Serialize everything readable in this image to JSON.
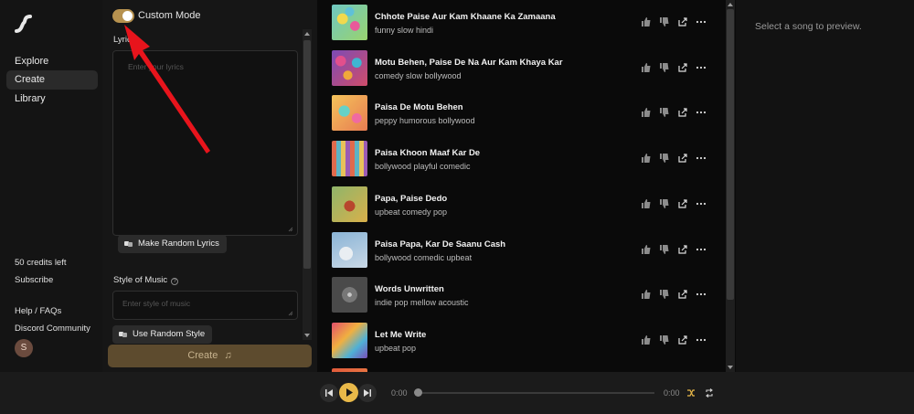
{
  "sidebar": {
    "nav": [
      {
        "label": "Explore"
      },
      {
        "label": "Create",
        "active": true
      },
      {
        "label": "Library"
      }
    ],
    "credits": "50 credits left",
    "subscribe": "Subscribe",
    "help": "Help / FAQs",
    "discord": "Discord Community",
    "avatar_initial": "S"
  },
  "create_panel": {
    "mode_label": "Custom Mode",
    "mode_on": true,
    "lyrics_label": "Lyrics",
    "lyrics_placeholder": "Enter your lyrics",
    "random_lyrics_label": "Make Random Lyrics",
    "style_label": "Style of Music",
    "style_placeholder": "Enter style of music",
    "random_style_label": "Use Random Style",
    "create_label": "Create"
  },
  "songs": [
    {
      "title": "Chhote Paise Aur Kam Khaane Ka Zamaana",
      "tags": "funny slow hindi"
    },
    {
      "title": "Motu Behen, Paise De Na Aur Kam Khaya Kar",
      "tags": "comedy slow bollywood"
    },
    {
      "title": "Paisa De Motu Behen",
      "tags": "peppy humorous bollywood"
    },
    {
      "title": "Paisa Khoon Maaf Kar De",
      "tags": "bollywood playful comedic"
    },
    {
      "title": "Papa, Paise Dedo",
      "tags": "upbeat comedy pop"
    },
    {
      "title": "Paisa Papa, Kar De Saanu Cash",
      "tags": "bollywood comedic upbeat"
    },
    {
      "title": "Words Unwritten",
      "tags": "indie pop mellow acoustic"
    },
    {
      "title": "Let Me Write",
      "tags": "upbeat pop"
    }
  ],
  "preview": {
    "empty_text": "Select a song to preview."
  },
  "player": {
    "current_time": "0:00",
    "total_time": "0:00",
    "progress": 0
  },
  "colors": {
    "accent": "#e9b949",
    "toggle": "#b7924f",
    "create_button": "#5d4b2e",
    "annotation": "#e8141c"
  }
}
